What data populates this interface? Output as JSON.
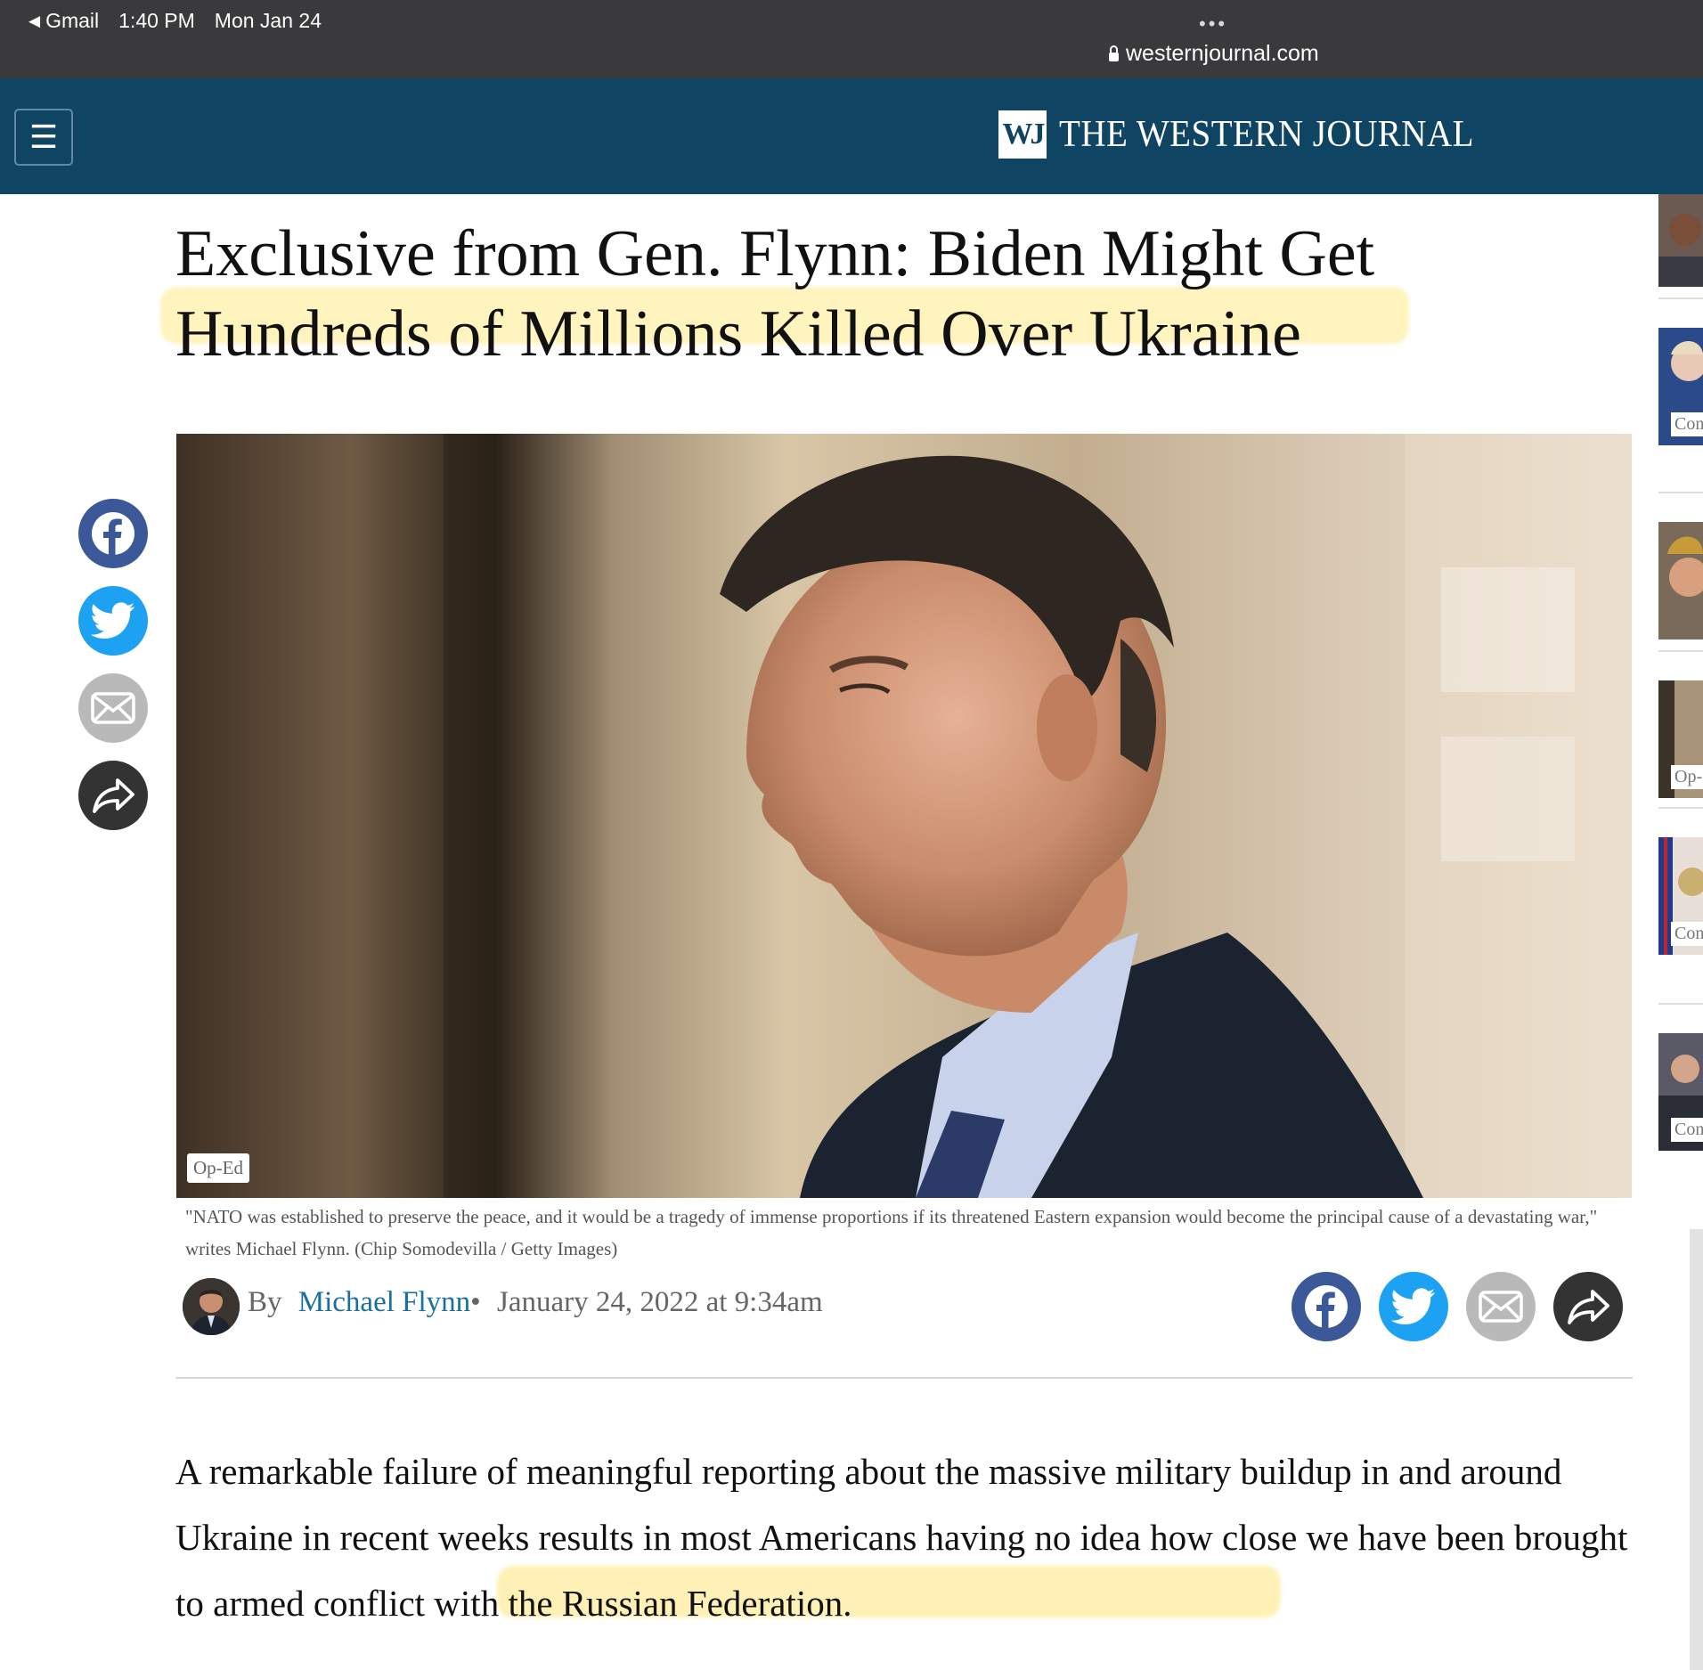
{
  "status_bar": {
    "back_app": "Gmail",
    "time": "1:40 PM",
    "date": "Mon Jan 24",
    "dots": "•••",
    "url": "westernjournal.com"
  },
  "site": {
    "menu_icon": "☰",
    "logo_mark": "WJ",
    "logo_text": "THE WESTERN JOURNAL",
    "brand_color": "#0f4462"
  },
  "article": {
    "headline": "Exclusive from Gen. Flynn: Biden Might Get Hundreds of Millions Killed Over Ukraine",
    "category_badge": "Op-Ed",
    "photo_caption": "\"NATO was established to preserve the peace, and it would be a tragedy of immense proportions if its threatened Eastern expansion would become the principal cause of a devastating war,\" writes Michael Flynn. (Chip Somodevilla / Getty Images)",
    "byline_prefix": "By",
    "author": "Michael Flynn",
    "separator": "•",
    "date": "January 24, 2022 at 9:34am",
    "body_paragraph": "A remarkable failure of meaningful reporting about the massive military buildup in and around Ukraine in recent weeks results in most Americans having no idea how close we have been brought to armed conflict with the Russian Federation."
  },
  "share": {
    "icons": [
      "facebook-icon",
      "twitter-icon",
      "email-icon",
      "share-icon"
    ],
    "colors": {
      "facebook": "#3b5998",
      "twitter": "#1da1f2",
      "email": "#b9b9b9",
      "share": "#333333"
    }
  },
  "sidebar": {
    "labels": [
      "Con",
      "Op-",
      "Con",
      "Con"
    ]
  }
}
